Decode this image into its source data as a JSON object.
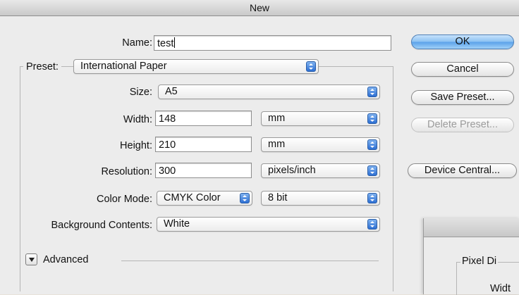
{
  "window": {
    "title": "New"
  },
  "form": {
    "name_label": "Name:",
    "name_value": "test",
    "preset_label": "Preset:",
    "preset_value": "International Paper",
    "size_label": "Size:",
    "size_value": "A5",
    "width_label": "Width:",
    "width_value": "148",
    "width_unit": "mm",
    "height_label": "Height:",
    "height_value": "210",
    "height_unit": "mm",
    "resolution_label": "Resolution:",
    "resolution_value": "300",
    "resolution_unit": "pixels/inch",
    "color_mode_label": "Color Mode:",
    "color_mode_value": "CMYK Color",
    "bit_depth_value": "8 bit",
    "background_label": "Background Contents:",
    "background_value": "White",
    "advanced_label": "Advanced"
  },
  "buttons": {
    "ok": "OK",
    "cancel": "Cancel",
    "save_preset": "Save Preset...",
    "delete_preset": "Delete Preset...",
    "device_central": "Device Central..."
  },
  "background_window": {
    "group_label": "Pixel Di",
    "field_label": "Widt"
  },
  "colors": {
    "default_button": "#8cc2f3",
    "dialog_bg": "#ececec",
    "popup_arrow": "#2d6fd3"
  }
}
